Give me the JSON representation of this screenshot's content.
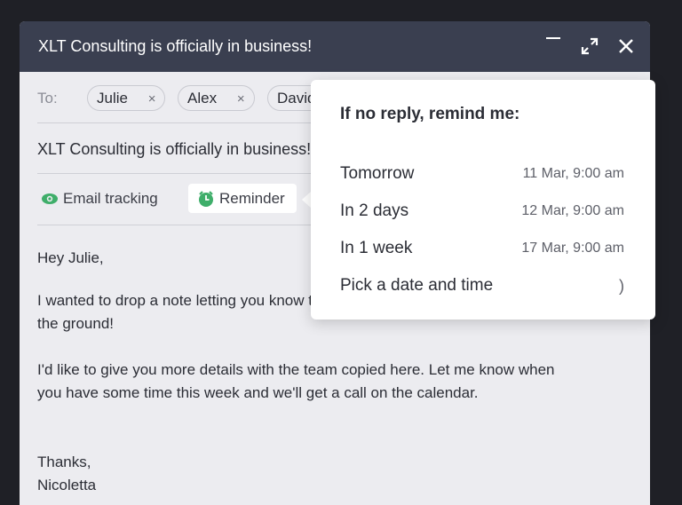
{
  "window": {
    "title": "XLT Consulting is officially in business!"
  },
  "recipients": {
    "label": "To:",
    "chips": [
      "Julie",
      "Alex",
      "David"
    ],
    "remove_symbol": "×"
  },
  "subject": "XLT Consulting is officially in business!",
  "tools": {
    "tracking_label": "Email tracking",
    "reminder_label": "Reminder"
  },
  "body": {
    "greeting": "Hey Julie,",
    "paragraph_1_line_1": "I wanted to drop a note letting you know that we are officially off",
    "paragraph_1_line_2": "the ground!",
    "paragraph_2_line_1": "I'd like to give you more details with the team copied here. Let me know when",
    "paragraph_2_line_2": "you have some time this week and we'll get a call on the calendar.",
    "closing": "Thanks,",
    "signature": "Nicoletta"
  },
  "reminder_menu": {
    "title": "If no reply, remind me:",
    "options": [
      {
        "label": "Tomorrow",
        "when": "11 Mar, 9:00 am"
      },
      {
        "label": "In 2 days",
        "when": "12 Mar, 9:00 am"
      },
      {
        "label": "In 1 week",
        "when": "17 Mar, 9:00 am"
      },
      {
        "label": "Pick a date and time",
        "when": ")"
      }
    ]
  },
  "colors": {
    "titlebar": "#3a3f50",
    "tracking_icon": "#3fae6a",
    "reminder_icon": "#3fae6a",
    "background": "#1f2026"
  }
}
